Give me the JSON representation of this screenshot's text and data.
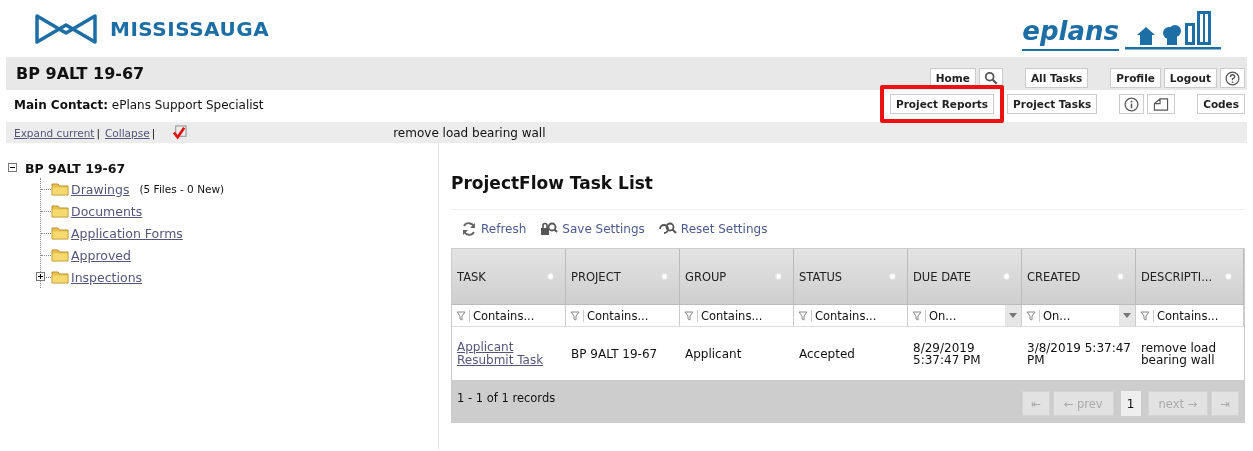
{
  "brand": {
    "name": "MISSISSAUGA",
    "product": "eplans"
  },
  "project": {
    "title": "BP 9ALT 19-67",
    "contact_label": "Main Contact:",
    "contact": "ePlans Support Specialist",
    "description": "remove load bearing wall"
  },
  "toolbar_top": [
    {
      "kind": "text",
      "label": "Home"
    },
    {
      "kind": "search"
    },
    {
      "kind": "gap"
    },
    {
      "kind": "text",
      "label": "All Tasks"
    },
    {
      "kind": "gap"
    },
    {
      "kind": "text",
      "label": "Profile"
    },
    {
      "kind": "text",
      "label": "Logout"
    },
    {
      "kind": "help"
    }
  ],
  "toolbar_bottom": [
    {
      "kind": "text",
      "label": "Project Reports",
      "highlighted": true
    },
    {
      "kind": "text",
      "label": "Project Tasks",
      "highlighted": false
    },
    {
      "kind": "gap"
    },
    {
      "kind": "info",
      "highlighted": false
    },
    {
      "kind": "note",
      "highlighted": false
    },
    {
      "kind": "gap"
    },
    {
      "kind": "text",
      "label": "Codes",
      "highlighted": false
    }
  ],
  "tree_links": [
    "Expand current",
    "Collapse"
  ],
  "tree_link_separator": "|",
  "tree": {
    "label": "BP 9ALT 19-67",
    "expanded": true,
    "children": [
      {
        "label": "Drawings",
        "note": "(5 Files - 0 New)"
      },
      {
        "label": "Documents"
      },
      {
        "label": "Application Forms"
      },
      {
        "label": "Approved"
      },
      {
        "label": "Inspections",
        "expanded": false
      }
    ]
  },
  "task_list": {
    "title": "ProjectFlow Task List",
    "actions": [
      {
        "kind": "refresh",
        "label": "Refresh"
      },
      {
        "kind": "save",
        "label": "Save Settings"
      },
      {
        "kind": "reset",
        "label": "Reset Settings"
      }
    ],
    "columns": [
      {
        "label": "TASK",
        "filter": "Contains...",
        "date": false
      },
      {
        "label": "PROJECT",
        "filter": "Contains...",
        "date": false
      },
      {
        "label": "GROUP",
        "filter": "Contains...",
        "date": false
      },
      {
        "label": "STATUS",
        "filter": "Contains...",
        "date": false
      },
      {
        "label": "DUE DATE",
        "filter": "On...",
        "date": true
      },
      {
        "label": "CREATED",
        "filter": "On...",
        "date": true
      },
      {
        "label": "DESCRIPTI...",
        "filter": "Contains...",
        "date": false
      }
    ],
    "rows": [
      {
        "cells": [
          "Applicant Resubmit Task",
          "BP 9ALT 19-67",
          "Applicant",
          "Accepted",
          "8/29/2019 5:37:47 PM",
          "3/8/2019 5:37:47 PM",
          "remove load bearing wall"
        ]
      }
    ],
    "records": "1 - 1 of 1 records",
    "pager": {
      "first": "⇤",
      "prev": "← prev",
      "page": "1",
      "next": "next →",
      "last": "⇥",
      "prev_disabled": true,
      "next_disabled": true
    }
  }
}
